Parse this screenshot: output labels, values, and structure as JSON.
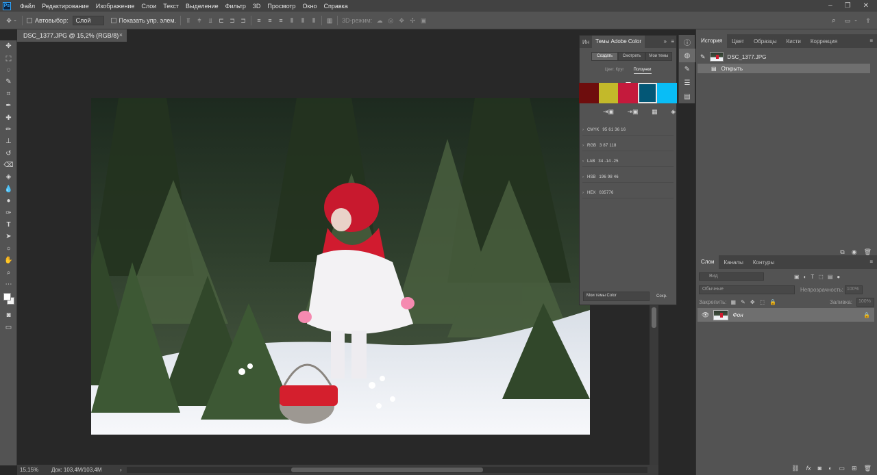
{
  "menu": {
    "logo": "Ps",
    "items": [
      "Файл",
      "Редактирование",
      "Изображение",
      "Слои",
      "Текст",
      "Выделение",
      "Фильтр",
      "3D",
      "Просмотр",
      "Окно",
      "Справка"
    ]
  },
  "options": {
    "autoselect_label": "Автовыбор:",
    "autoselect_value": "Слой",
    "show_transform_label": "Показать упр. элем.",
    "mode3d_label": "3D-режим:"
  },
  "document": {
    "tab_title": "DSC_1377.JPG @ 15,2% (RGB/8)",
    "close": "×"
  },
  "status": {
    "zoom": "15,15%",
    "doc_size": "Док: 103,4M/103,4M",
    "arrow": "›"
  },
  "color_panel": {
    "tab_short": "Ин",
    "tab_active": "Темы Adobe Color",
    "more": "»",
    "menu": "≡",
    "modes": [
      "Создать",
      "Смотреть",
      "Мои темы"
    ],
    "sub_tabs": [
      "Цвет. Круг",
      "Ползунки"
    ],
    "swatches": [
      "#6e0d0d",
      "#c3b92a",
      "#c41a3c",
      "#035776",
      "#09bdf6"
    ],
    "selected_swatch_index": 3,
    "values": [
      {
        "label": "CMYK",
        "value": "95  61  36  16"
      },
      {
        "label": "RGB",
        "value": "3  87  118"
      },
      {
        "label": "LAB",
        "value": "34  -14  -25"
      },
      {
        "label": "HSB",
        "value": "196  98  46"
      },
      {
        "label": "HEX",
        "value": "035776"
      }
    ],
    "theme_name": "Мои темы Color",
    "save_label": "Сохр."
  },
  "history_panel": {
    "tabs": [
      "История",
      "Цвет",
      "Образцы",
      "Кисти",
      "Коррекция"
    ],
    "snapshot": "DSC_1377.JPG",
    "step": "Открыть"
  },
  "layers_panel": {
    "tabs": [
      "Слои",
      "Каналы",
      "Контуры"
    ],
    "filter_placeholder": "Вид",
    "blend_mode": "Обычные",
    "opacity_label": "Непрозрачность:",
    "opacity_value": "100%",
    "lock_label": "Закрепить:",
    "fill_label": "Заливка:",
    "fill_value": "100%",
    "layer_name": "Фон"
  }
}
